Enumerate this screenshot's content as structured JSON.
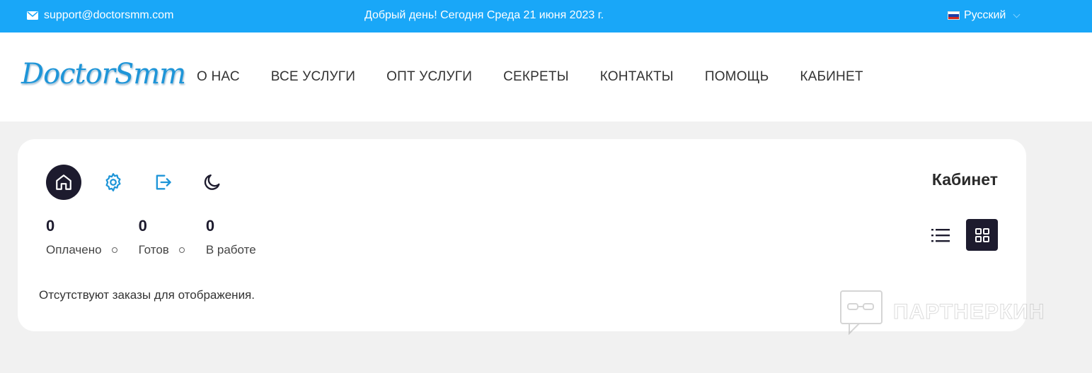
{
  "topbar": {
    "email": "support@doctorsmm.com",
    "greeting": "Добрый день! Сегодня Среда 21 июня 2023 г.",
    "language": "Русский"
  },
  "logo": {
    "text": "DoctorSmm"
  },
  "nav": {
    "items": [
      "О НАС",
      "ВСЕ УСЛУГИ",
      "ОПТ УСЛУГИ",
      "СЕКРЕТЫ",
      "КОНТАКТЫ",
      "ПОМОЩЬ",
      "КАБИНЕТ"
    ]
  },
  "cabinet": {
    "title": "Кабинет",
    "icons": [
      "home-icon",
      "gear-icon",
      "logout-icon",
      "moon-icon"
    ],
    "stats": [
      {
        "value": "0",
        "label": "Оплачено"
      },
      {
        "value": "0",
        "label": "Готов"
      },
      {
        "value": "0",
        "label": "В работе"
      }
    ],
    "empty_message": "Отсутствуют заказы для отображения."
  },
  "watermark": {
    "text": "ПАРТНЕРКИН"
  },
  "colors": {
    "topbar": "#19a7f8",
    "accent": "#1e95d8",
    "dark": "#1d1b2e",
    "background": "#f1f1f1"
  }
}
